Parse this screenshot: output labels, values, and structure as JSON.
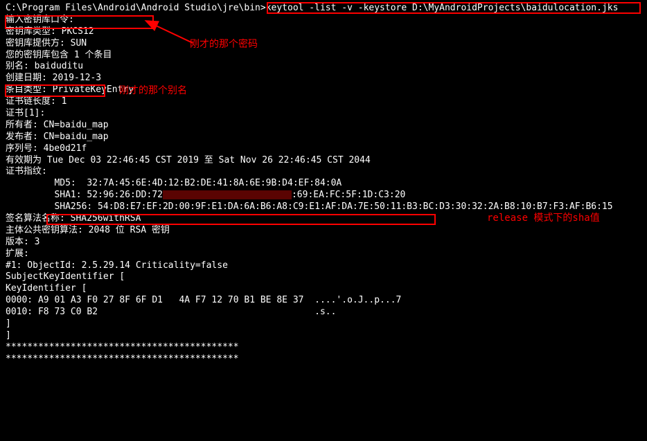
{
  "prompt_path": "C:\\Program Files\\Android\\Android Studio\\jre\\bin>",
  "command": "keytool -list -v -keystore D:\\MyAndroidProjects\\baidulocation.jks",
  "lines": {
    "enter_password": "输入密钥库口令:",
    "keystore_type": "密钥库类型: PKCS12",
    "keystore_provider": "密钥库提供方: SUN",
    "blank1": "",
    "entry_count": "您的密钥库包含 1 个条目",
    "blank2": "",
    "alias": "别名: baiduditu",
    "creation_date": "创建日期: 2019-12-3",
    "entry_type": "条目类型: PrivateKeyEntry",
    "cert_chain_len": "证书链长度: 1",
    "cert_index": "证书[1]:",
    "owner": "所有者: CN=baidu_map",
    "issuer": "发布者: CN=baidu_map",
    "serial": "序列号: 4be0d21f",
    "validity": "有效期为 Tue Dec 03 22:46:45 CST 2019 至 Sat Nov 26 22:46:45 CST 2044",
    "fingerprint_label": "证书指纹:",
    "md5": "         MD5:  32:7A:45:6E:4D:12:B2:DE:41:8A:6E:9B:D4:EF:84:0A",
    "sha1_prefix": "         SHA1: 52:96:26:DD:72",
    "sha1_suffix": ":69:EA:FC:5F:1D:C3:20",
    "sha256": "         SHA256: 54:D8:E7:EF:2D:00:9F:E1:DA:6A:B6:A8:C9:E1:AF:DA:7E:50:11:B3:BC:D3:30:32:2A:B8:10:B7:F3:AF:B6:15",
    "sig_alg": "签名算法名称: SHA256withRSA",
    "pub_key_alg": "主体公共密钥算法: 2048 位 RSA 密钥",
    "version": "版本: 3",
    "blank3": "",
    "extensions": "扩展:",
    "blank4": "",
    "ext1": "#1: ObjectId: 2.5.29.14 Criticality=false",
    "ext2": "SubjectKeyIdentifier [",
    "ext3": "KeyIdentifier [",
    "hex1": "0000: A9 01 A3 F0 27 8F 6F D1   4A F7 12 70 B1 BE 8E 37  ....'.o.J..p...7",
    "hex2": "0010: F8 73 C0 B2                                        .s..",
    "ext4": "]",
    "ext5": "]",
    "blank5": "",
    "blank6": "",
    "blank7": "",
    "stars1": "*******************************************",
    "stars2": "*******************************************"
  },
  "annotations": {
    "password_hint": "刚才的那个密码",
    "alias_hint": "刚才的那个别名",
    "sha_hint": "release 模式下的sha值"
  }
}
